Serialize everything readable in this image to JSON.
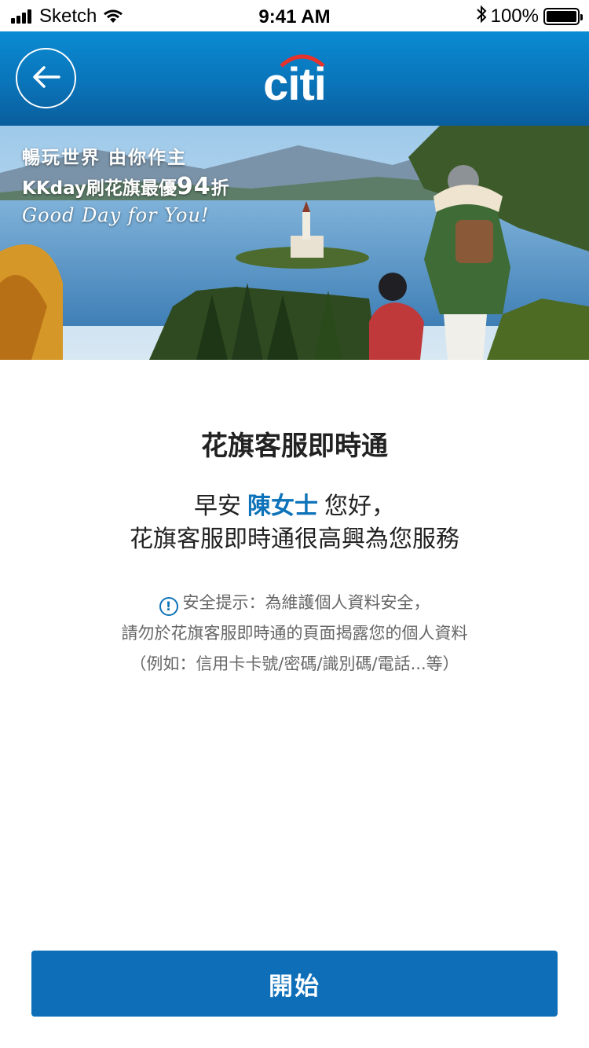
{
  "status_bar": {
    "carrier": "Sketch",
    "time": "9:41 AM",
    "battery": "100%"
  },
  "header": {
    "logo_text": "citi",
    "back_icon": "arrow-left-icon",
    "brand_color": "#0a74b9",
    "accent_arc_color": "#e5322d"
  },
  "banner": {
    "line1": "暢玩世界 由你作主",
    "line2_prefix": "KKday刷花旗最優",
    "line2_number": "94",
    "line2_suffix": "折",
    "line3": "Good Day for You!"
  },
  "main": {
    "title": "花旗客服即時通",
    "greeting_prefix": "早安",
    "customer_name": "陳女士",
    "greeting_suffix": "您好，",
    "greeting_line2": "花旗客服即時通很高興為您服務",
    "notice_icon": "info-icon",
    "notice_line1": "安全提示：為維護個人資料安全，",
    "notice_line2": "請勿於花旗客服即時通的頁面揭露您的個人資料",
    "notice_line3": "（例如：信用卡卡號/密碼/識別碼/電話...等）",
    "name_color": "#0e73b8"
  },
  "actions": {
    "start_label": "開始",
    "button_color": "#0e6fb8"
  }
}
